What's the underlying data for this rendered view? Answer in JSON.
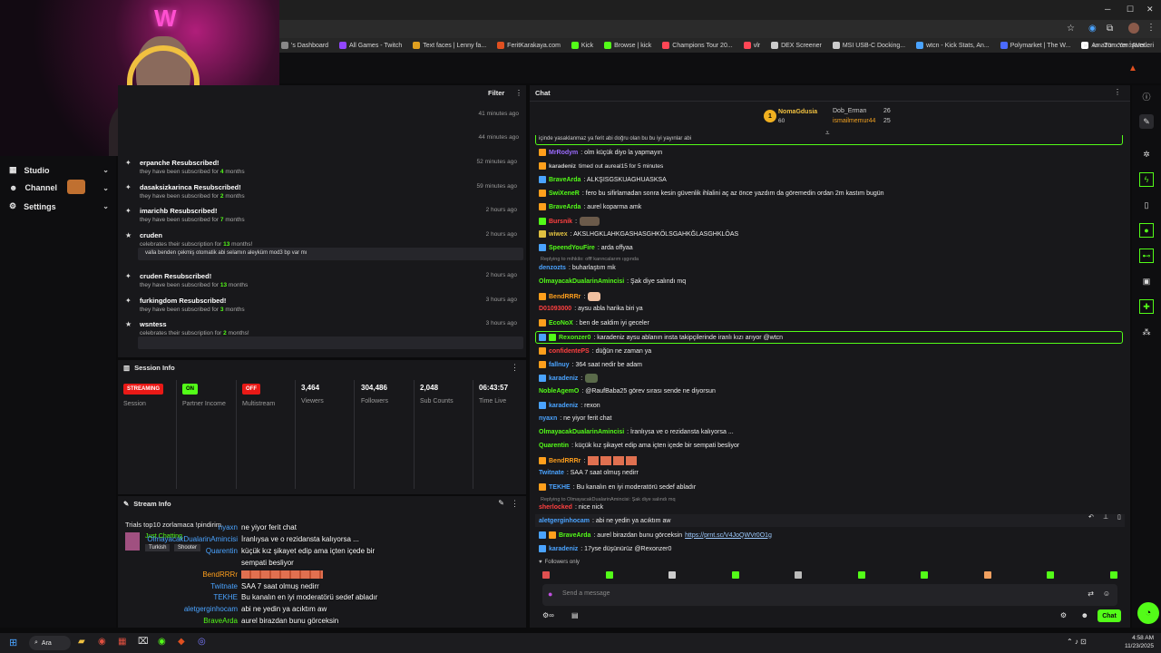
{
  "bookmarks": [
    "'s Dashboard",
    "All Games - Twitch",
    "Text faces | Lenny fa...",
    "FeritKarakaya.com",
    "Kick",
    "Browse | kick",
    "Champions Tour 20...",
    "vlr",
    "DEX Screener",
    "MSI USB-C Docking...",
    "wtcn - Kick Stats, An...",
    "Polymarket | The W...",
    "Amazon.com: AVer..."
  ],
  "bookmarks_right": "Tüm Yer İşaretleri",
  "nav": {
    "studio": "Studio",
    "channel": "Channel",
    "settings": "Settings"
  },
  "activity": {
    "filter": "Filter",
    "times_top": [
      "41 minutes ago",
      "44 minutes ago"
    ],
    "rows": [
      {
        "title": "erpanche Resubscribed!",
        "sub_pre": "they have been subscribed for ",
        "sub_num": "4",
        "sub_post": " months",
        "time": "52 minutes ago"
      },
      {
        "title": "dasaksizkarinca Resubscribed!",
        "sub_pre": "they have been subscribed for ",
        "sub_num": "2",
        "sub_post": " months",
        "time": "59 minutes ago"
      },
      {
        "title": "imarichb Resubscribed!",
        "sub_pre": "they have been subscribed for ",
        "sub_num": "7",
        "sub_post": " months",
        "time": "2 hours ago"
      },
      {
        "title": "cruden",
        "sub_pre": "celebrates their subscription for ",
        "sub_num": "13",
        "sub_post": " months!",
        "time": "2 hours ago",
        "msg": "valla benden çekmiş otomatik abi selamın aleyküm mod3 bp var mı"
      },
      {
        "title": "cruden Resubscribed!",
        "sub_pre": "they have been subscribed for ",
        "sub_num": "13",
        "sub_post": " months",
        "time": "2 hours ago"
      },
      {
        "title": "furkingdom Resubscribed!",
        "sub_pre": "they have been subscribed for ",
        "sub_num": "3",
        "sub_post": " months",
        "time": "3 hours ago"
      },
      {
        "title": "wsntess",
        "sub_pre": "celebrates their subscription for ",
        "sub_num": "2",
        "sub_post": " months!",
        "time": "3 hours ago",
        "msg": " "
      }
    ]
  },
  "session": {
    "title": "Session Info",
    "stats": [
      {
        "badge": "STREAMING",
        "badge_color": "#e91916",
        "label": "Session"
      },
      {
        "badge": "ON",
        "badge_color": "#53fc18",
        "label": "Partner Income"
      },
      {
        "badge": "OFF",
        "badge_color": "#e91916",
        "label": "Multistream"
      },
      {
        "value": "3,464",
        "label": "Viewers"
      },
      {
        "value": "304,486",
        "label": "Followers"
      },
      {
        "value": "2,048",
        "label": "Sub Counts"
      },
      {
        "value": "06:43:57",
        "label": "Time Live"
      }
    ]
  },
  "streaminfo": {
    "title": "Stream Info",
    "stream_title": "Trials top10 zorlamaca !pindirim",
    "category": "Just Chatting",
    "tags": [
      "Turkish",
      "Shooter"
    ],
    "overlay": [
      {
        "name": "nyaxn",
        "text": "ne yiyor ferit chat",
        "color": "#4aa3ff"
      },
      {
        "name": "OlmayacakDualarinAmincisi",
        "text": "İranlıysa ve o rezidansta kalıyorsa ...",
        "color": "#4aa3ff"
      },
      {
        "name": "Quarentin",
        "text": "küçük kız şikayet edip ama içten içede bir",
        "color": "#4aa3ff"
      },
      {
        "name": "",
        "text": "sempati besliyor",
        "color": "#fff"
      },
      {
        "name": "BendRRRr",
        "text": "",
        "color": "#ff9f1c"
      },
      {
        "name": "Twitnate",
        "text": "SAA 7 saat olmuş nedirr",
        "color": "#4aa3ff"
      },
      {
        "name": "TEKHE",
        "text": "Bu kanalın en iyi moderatörü sedef abladır",
        "color": "#4aa3ff"
      },
      {
        "name": "aletgerginhocam",
        "text": "abi ne yedin ya acıktım aw",
        "color": "#4aa3ff"
      },
      {
        "name": "BraveArda",
        "text": "aurel birazdan bunu görceksin",
        "color": "#53fc18"
      },
      {
        "name": "",
        "text": "https://prnt.sc/V4JoQWVr0O1g",
        "color": "#fff"
      },
      {
        "name": "karadeniz",
        "text": "17yse düşünürüz @Rexonzer0",
        "color": "#4aa3ff"
      }
    ]
  },
  "chat": {
    "title": "Chat",
    "leaderboard": [
      {
        "rank": "1",
        "name": "NomaGdusia",
        "value": "60"
      },
      {
        "name": "Dob_Erman",
        "value": "26"
      },
      {
        "name": "ismailmemur44",
        "value": "25"
      }
    ],
    "messages": [
      {
        "user": "",
        "text": "içinde yasaklanmaz ya ferit abi doğru olan bu bu iyi yayınlar abi",
        "color": "#ccc"
      },
      {
        "user": "MrRodym",
        "text": ": olm küçük diyo la yapmayın",
        "color": "#9b6bff"
      },
      {
        "user": "karadeniz",
        "text": " timed out aureal15 for 5 minutes",
        "color": "#ccc"
      },
      {
        "user": "BraveArda",
        "text": ": ALKŞISGSKUAGHUASKSA",
        "color": "#53fc18"
      },
      {
        "user": "SwiXeneR",
        "text": ": fero bu sifirlamadan sonra kesin güvenlik ihlalini aç az önce yazdım da göremedin ordan 2m kastım bugün",
        "color": "#53fc18"
      },
      {
        "user": "BraveArda",
        "text": ": aurel koparma amk",
        "color": "#53fc18"
      },
      {
        "user": "Bursnik",
        "text": ":",
        "color": "#ff4040"
      },
      {
        "user": "wiwex",
        "text": ": AKSLHGKLAHKGASHASGHKÖLSGAHKĞLASGHKLÖAS",
        "color": "#e0c040"
      },
      {
        "user": "SpeendYouFire",
        "text": ": arda offyaa",
        "color": "#53fc18"
      },
      {
        "user": "denzozts",
        "text": ": buharlaştım mk",
        "color": "#4aa3ff"
      },
      {
        "user": "OlmayacakDualarinAmincisi",
        "text": ": Şak diye salındı mq",
        "color": "#53fc18"
      },
      {
        "user": "BendRRRr",
        "text": ":",
        "color": "#ff9f1c"
      },
      {
        "user": "D01093000",
        "text": ": aysu abla harika biri ya",
        "color": "#ff4040"
      },
      {
        "user": "EcoNoX",
        "text": ": ben de saldim iyi geceler",
        "color": "#53fc18"
      },
      {
        "user": "Rexonzer0",
        "text": ": karadeniz aysu ablanın insta takipçilerinde iranlı kızı arıyor @wtcn",
        "color": "#53fc18"
      },
      {
        "user": "confidentePS",
        "text": ": düğün ne zaman ya",
        "color": "#ff4040"
      },
      {
        "user": "fallnuy",
        "text": ": 364 saat nedir be adam",
        "color": "#4aa3ff"
      },
      {
        "user": "karadeniz",
        "text": ":",
        "color": "#4aa3ff"
      },
      {
        "user": "NobleAgemO",
        "text": ": @RaufBaba25 görev sırası sende ne diyorsun",
        "color": "#53fc18"
      },
      {
        "user": "karadeniz",
        "text": ": rexon",
        "color": "#4aa3ff"
      },
      {
        "user": "nyaxn",
        "text": ": ne yiyor ferit chat",
        "color": "#4aa3ff"
      },
      {
        "user": "OlmayacakDualarinAmincisi",
        "text": ": İranlıysa ve o rezidansta kalıyorsa ...",
        "color": "#53fc18"
      },
      {
        "user": "Quarentin",
        "text": ": küçük kız şikayet edip ama içten içede bir sempati besliyor",
        "color": "#53fc18"
      },
      {
        "user": "BendRRRr",
        "text": ":",
        "color": "#ff9f1c"
      },
      {
        "user": "Twitnate",
        "text": ": SAA 7 saat olmuş nedirr",
        "color": "#4aa3ff"
      },
      {
        "user": "TEKHE",
        "text": ": Bu kanalın en iyi moderatörü sedef abladır",
        "color": "#4aa3ff"
      },
      {
        "user": "sherlocked",
        "text": ": nice nick",
        "color": "#ff4040"
      },
      {
        "user": "aletgerginhocam",
        "text": ": abi ne yedin ya acıktım aw",
        "color": "#4aa3ff"
      },
      {
        "user": "BraveArda",
        "text": ": aurel birazdan bunu görceksin ",
        "link": "https://prnt.sc/V4JoQWVr0O1g",
        "color": "#53fc18"
      },
      {
        "user": "karadeniz",
        "text": ": 17yse düşünürüz @Rexonzer0",
        "color": "#4aa3ff"
      }
    ],
    "reply1": "Replying to mihkilo: offf karıncalarım ışgında",
    "reply2": "Replying to OlmayacakDualarinAmincisi: Şak diye salındı mq",
    "followers_only": "Followers only",
    "input_placeholder": "Send a message",
    "chat_button": "Chat"
  },
  "taskbar": {
    "search": "Ara",
    "time": "4:58 AM",
    "date": "11/23/2025"
  },
  "colors": {
    "kick_green": "#53fc18",
    "red": "#e91916",
    "panel": "#18181b"
  }
}
